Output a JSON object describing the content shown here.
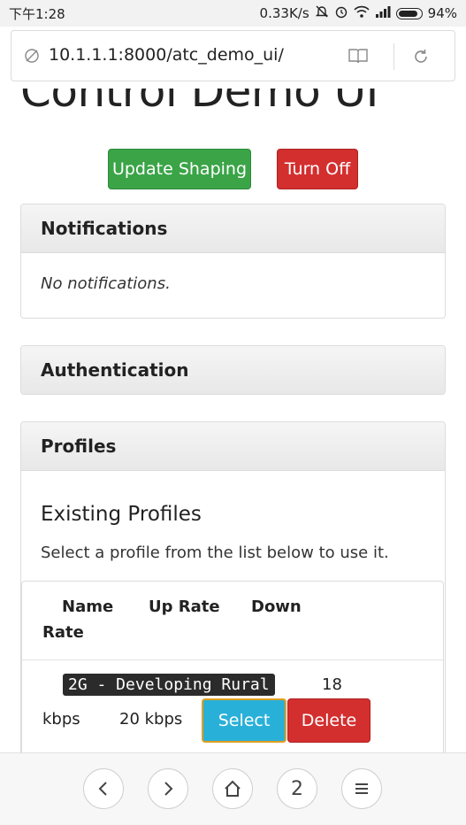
{
  "status_bar": {
    "time": "下午1:28",
    "net_speed": "0.33K/s",
    "battery": "94%",
    "battery_level": 0.94
  },
  "browser": {
    "url": "10.1.1.1:8000/atc_demo_ui/"
  },
  "page": {
    "title": "Control Demo UI",
    "update_shaping_label": "Update Shaping",
    "turn_off_label": "Turn Off",
    "notifications": {
      "heading": "Notifications",
      "empty_text": "No notifications."
    },
    "authentication": {
      "heading": "Authentication"
    },
    "profiles": {
      "heading": "Profiles",
      "subheading": "Existing Profiles",
      "help_text": "Select a profile from the list below to use it.",
      "columns": [
        "Name",
        "Up Rate",
        "Down",
        "Rate"
      ],
      "rows": [
        {
          "name": "2G - Developing Rural",
          "down_rate_num": "18",
          "down_rate_unit": "kbps",
          "up_rate": "20 kbps",
          "select_label": "Select",
          "delete_label": "Delete"
        }
      ]
    }
  },
  "bottom_nav": {
    "tab_count": "2"
  },
  "colors": {
    "green": "#3aa447",
    "red": "#d32f2f",
    "blue": "#29b0d8"
  }
}
